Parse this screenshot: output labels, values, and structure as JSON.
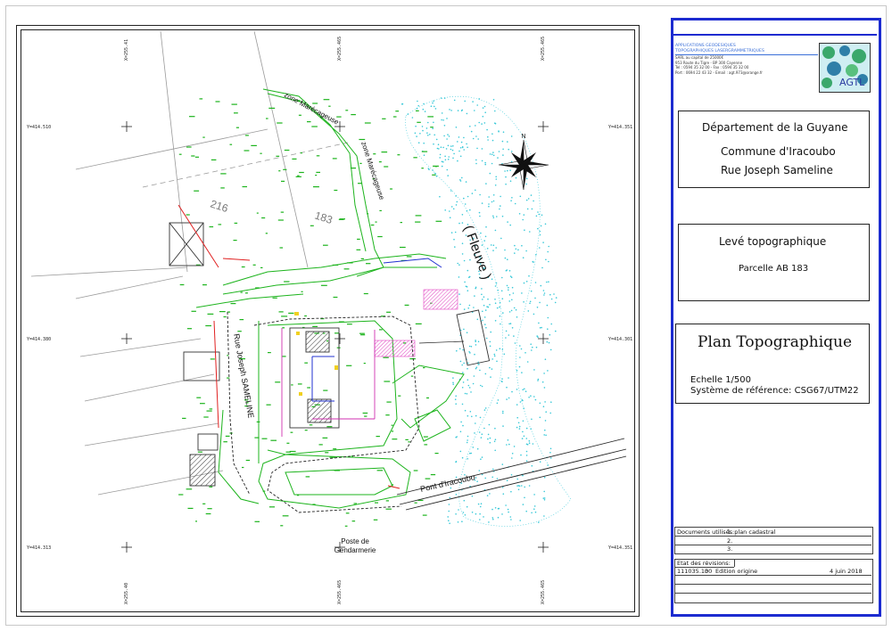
{
  "map": {
    "labels": {
      "zone_top": "zone Marécageuse",
      "zone_right": "zone Marécageuse",
      "parcel_216": "216",
      "parcel_183": "183",
      "fleuve": "( Fleuve )",
      "rue": "Rue Joseph SAMELINE",
      "pont": "Pont d'Iracoubo",
      "poste": "Poste de",
      "gendarmerie": "Gendarmerie",
      "north": "N"
    },
    "coords": {
      "y_top": "Y=414.510",
      "y_mid": "Y=414.380",
      "y_bot": "Y=414.313",
      "y_top_r": "Y=414.351",
      "y_mid_r": "Y=414.301",
      "y_bot_r": "Y=414.351",
      "x_top_1": "X=255.41",
      "x_top_2": "X=255.465",
      "x_top_3": "X=255.465",
      "x_bot_1": "X=255.40",
      "x_bot_2": "X=255.465",
      "x_bot_3": "X=255.465"
    }
  },
  "cartouche": {
    "company": {
      "name1": "APPLICATIONS GEODESIQUES",
      "name2": "TOPOGRAPHIQUES LASERGRAMMETRIQUES",
      "capital": "SARL au capital de 25000€",
      "address": "953 Route du Tigre - BP 300 Cayenne",
      "phone": "Tel : 0594 35 32 00 - Fax : 0594 35 32 00",
      "contact": "Port : 0694 22 43 32 - Email : agt.973@orange.fr"
    },
    "logo": "AGTL",
    "location": {
      "line1": "Département de la Guyane",
      "line2": "Commune d'Iracoubo",
      "line3": "Rue Joseph Sameline"
    },
    "survey": {
      "line1": "Levé  topographique",
      "line2": "Parcelle AB 183"
    },
    "plan": {
      "title": "Plan  Topographique",
      "scale": "Echelle 1/500",
      "reference": "Système de référence: CSG67/UTM22"
    },
    "documents": {
      "label": "Documents utilisés:",
      "item1": "1. plan cadastral",
      "item2": "2.",
      "item3": "3."
    },
    "revisions": {
      "label": "Etat des révisions:",
      "ref": "111035.13",
      "version": "00",
      "edition": "Edition origine",
      "date": "4 juin 2018"
    }
  }
}
